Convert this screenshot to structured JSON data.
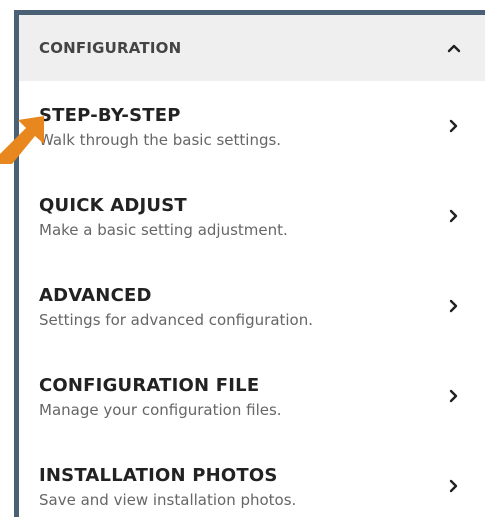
{
  "panel": {
    "title": "CONFIGURATION",
    "collapse_icon": "chevron-up-icon"
  },
  "menu": {
    "items": [
      {
        "title": "STEP-BY-STEP",
        "description": "Walk through the basic settings.",
        "icon": "chevron-right-icon"
      },
      {
        "title": "QUICK ADJUST",
        "description": "Make a basic setting adjustment.",
        "icon": "chevron-right-icon"
      },
      {
        "title": "ADVANCED",
        "description": "Settings for advanced configuration.",
        "icon": "chevron-right-icon"
      },
      {
        "title": "CONFIGURATION FILE",
        "description": "Manage your configuration files.",
        "icon": "chevron-right-icon"
      },
      {
        "title": "INSTALLATION PHOTOS",
        "description": "Save and view installation photos.",
        "icon": "chevron-right-icon"
      }
    ]
  },
  "annotation": {
    "icon": "pointer-arrow-icon",
    "color": "#e8871e"
  },
  "colors": {
    "frame_border": "#4a6175",
    "header_background": "#efefef"
  }
}
